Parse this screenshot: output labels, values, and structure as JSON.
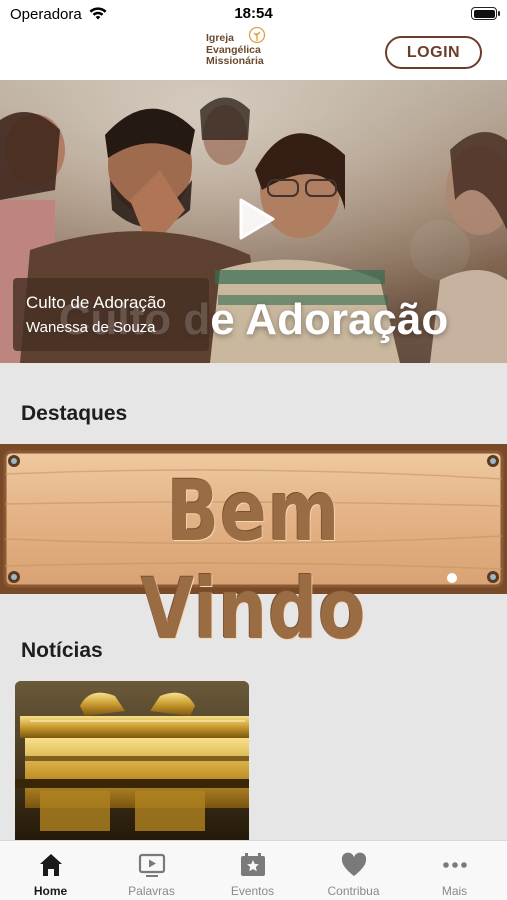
{
  "status_bar": {
    "carrier": "Operadora",
    "time": "18:54"
  },
  "header": {
    "logo_lines": [
      "Igreja",
      "Evangélica",
      "Missionária"
    ],
    "login_label": "LOGIN"
  },
  "hero": {
    "overlay_title": "Culto de Adoração",
    "card_title": "Culto de Adoração",
    "card_subtitle": "Wanessa de Souza"
  },
  "sections": {
    "highlights_title": "Destaques",
    "news_title": "Notícias"
  },
  "banner": {
    "text": "Bem Vindo"
  },
  "tabbar": {
    "items": [
      {
        "label": "Home",
        "icon": "home-icon",
        "active": true
      },
      {
        "label": "Palavras",
        "icon": "play-screen-icon",
        "active": false
      },
      {
        "label": "Eventos",
        "icon": "calendar-star-icon",
        "active": false
      },
      {
        "label": "Contribua",
        "icon": "heart-icon",
        "active": false
      },
      {
        "label": "Mais",
        "icon": "more-icon",
        "active": false
      }
    ]
  },
  "colors": {
    "brand": "#6b3d2a",
    "background": "#e6e6e6"
  }
}
